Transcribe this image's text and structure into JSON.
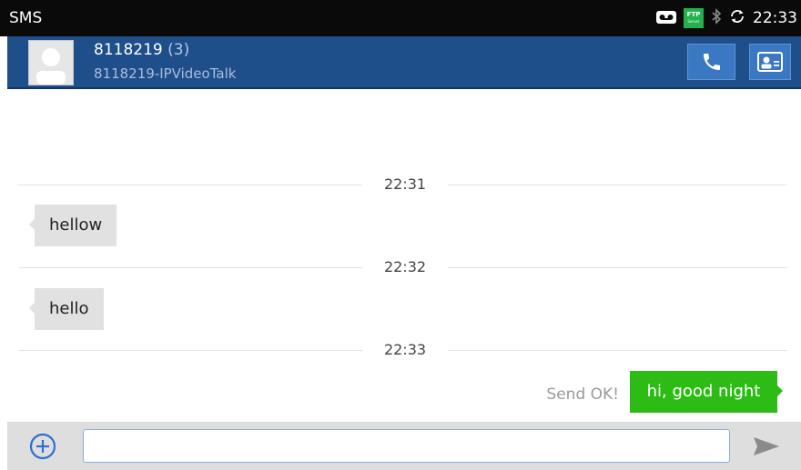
{
  "status_bar": {
    "app_title": "SMS",
    "ftp_label": "FTP",
    "ftp_sub": "Server",
    "time": "22:33"
  },
  "header": {
    "contact_number": "8118219",
    "message_count": "(3)",
    "contact_subtitle": "8118219-IPVideoTalk",
    "call_icon": "phone-icon",
    "contact_card_icon": "contact-card-icon"
  },
  "conversation": {
    "dividers": [
      "22:31",
      "22:32",
      "22:33"
    ],
    "incoming": [
      "hellow",
      "hello"
    ],
    "outgoing": {
      "text": "hi, good night",
      "status": "Send OK!"
    }
  },
  "composer": {
    "input_value": "",
    "input_placeholder": "",
    "add_icon": "add-circle-icon",
    "send_icon": "send-icon"
  },
  "colors": {
    "header_bg": "#1f4f8b",
    "outgoing_bubble": "#2dbb15",
    "incoming_bubble": "#e1e1e1"
  }
}
